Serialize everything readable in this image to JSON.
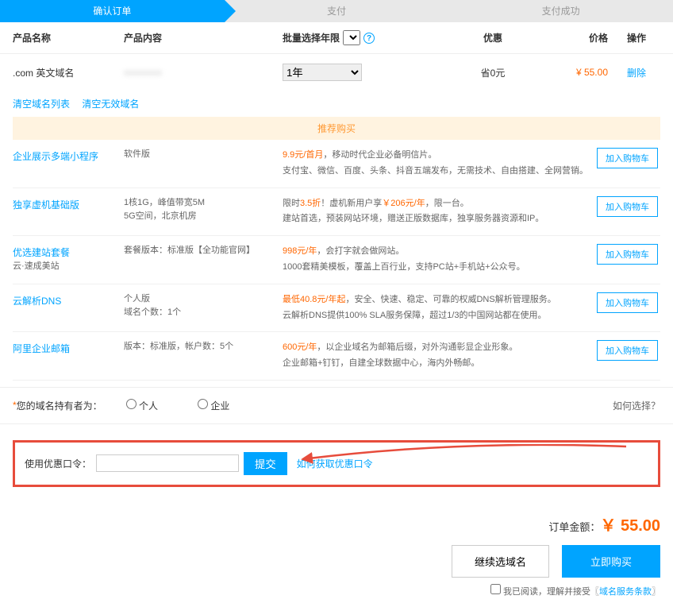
{
  "steps": {
    "confirm": "确认订单",
    "pay": "支付",
    "success": "支付成功"
  },
  "header": {
    "name": "产品名称",
    "content": "产品内容",
    "year": "批量选择年限",
    "discount": "优惠",
    "price": "价格",
    "action": "操作"
  },
  "row": {
    "name": ".com 英文域名",
    "content_blur": "xxxxxxxx",
    "year": "1年",
    "discount": "省0元",
    "price": "¥ 55.00",
    "action": "删除"
  },
  "clear": {
    "list": "清空域名列表",
    "invalid": "清空无效域名"
  },
  "promo_header": "推荐购买",
  "promos": [
    {
      "name": "企业展示多端小程序",
      "content": "软件版",
      "desc1_hl": "9.9元/首月",
      "desc1": "，移动时代企业必备明信片。",
      "desc2": "支付宝、微信、百度、头条、抖音五端发布，无需技术、自由搭建、全网营销。"
    },
    {
      "name": "独享虚机基础版",
      "content": "1核1G，峰值带宽5M\n5G空间，北京机房",
      "desc1_pre": "限时",
      "desc1_hl": "3.5折",
      "desc1": "！虚机新用户享",
      "desc1_hl2": "￥206元/年",
      "desc1_post": "，限一台。",
      "desc2": "建站首选，预装网站环境，赠送正版数据库，独享服务器资源和IP。"
    },
    {
      "name": "优选建站套餐",
      "sub": "云·速成美站",
      "content": "套餐版本：标准版【全功能官网】",
      "desc1_hl": "998元/年",
      "desc1": "，会打字就会做网站。",
      "desc2": "1000套精美模板，覆盖上百行业，支持PC站+手机站+公众号。"
    },
    {
      "name": "云解析DNS",
      "content": "个人版\n域名个数：1个",
      "desc1_hl": "最低40.8元/年起",
      "desc1": "，安全、快速、稳定、可靠的权威DNS解析管理服务。",
      "desc2": "云解析DNS提供100% SLA服务保障，超过1/3的中国网站都在使用。"
    },
    {
      "name": "阿里企业邮箱",
      "content": "版本：标准版，帐户数：5个",
      "desc1_hl": "600元/年",
      "desc1": "，以企业域名为邮箱后缀，对外沟通彰显企业形象。",
      "desc2": "企业邮箱+钉钉，自建全球数据中心，海内外畅邮。"
    }
  ],
  "add_cart": "加入购物车",
  "owner": {
    "label": "您的域名持有者为：",
    "personal": "个人",
    "company": "企业",
    "how": "如何选择？"
  },
  "coupon": {
    "label": "使用优惠口令：",
    "submit": "提交",
    "how": "如何获取优惠口令"
  },
  "footer": {
    "total_label": "订单金额：",
    "total": "￥ 55.00",
    "continue": "继续选域名",
    "buy": "立即购买",
    "agree_pre": "我已阅读，理解并接受〖",
    "agree_link": "域名服务条款",
    "agree_post": "〗"
  }
}
